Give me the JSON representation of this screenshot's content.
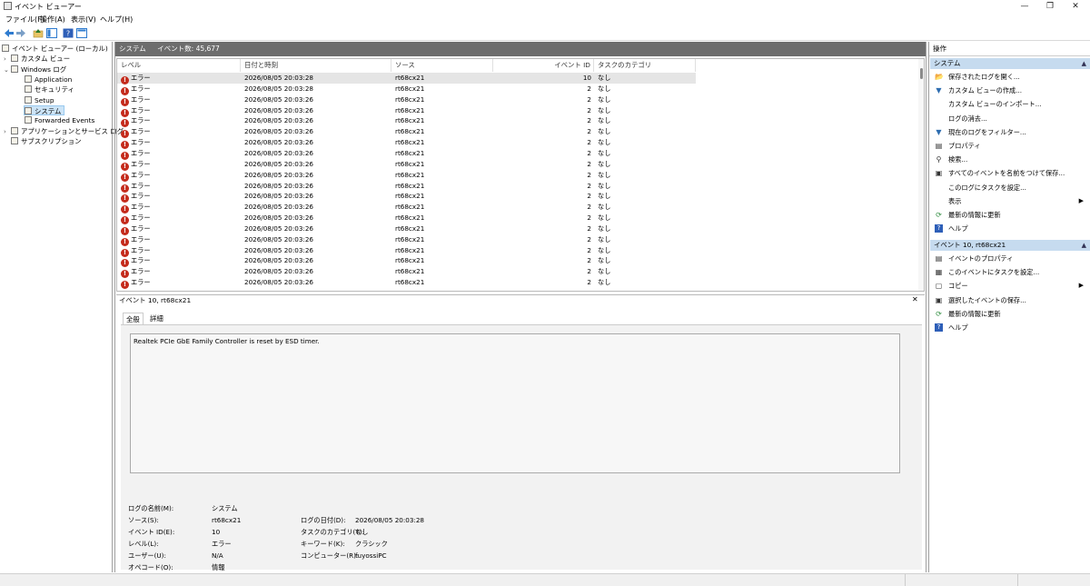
{
  "window": {
    "title": "イベント ビューアー",
    "min_glyph": "—",
    "max_glyph": "❐",
    "close_glyph": "✕"
  },
  "menu": [
    "ファイル(F)",
    "操作(A)",
    "表示(V)",
    "ヘルプ(H)"
  ],
  "tree": {
    "root": "イベント ビューアー (ローカル)",
    "custom_views": "カスタム ビュー",
    "windows_logs": "Windows ログ",
    "logs": [
      "Application",
      "セキュリティ",
      "Setup",
      "システム",
      "Forwarded Events"
    ],
    "app_services": "アプリケーションとサービス ログ",
    "subscriptions": "サブスクリプション"
  },
  "center": {
    "log_name": "システム",
    "event_count": "イベント数: 45,677"
  },
  "grid": {
    "columns": [
      "レベル",
      "日付と時刻",
      "ソース",
      "イベント ID",
      "タスクのカテゴリ"
    ],
    "rows": [
      {
        "level": "エラー",
        "datetime": "2026/08/05 20:03:28",
        "source": "rt68cx21",
        "event_id": "10",
        "category": "なし"
      },
      {
        "level": "エラー",
        "datetime": "2026/08/05 20:03:28",
        "source": "rt68cx21",
        "event_id": "2",
        "category": "なし"
      },
      {
        "level": "エラー",
        "datetime": "2026/08/05 20:03:26",
        "source": "rt68cx21",
        "event_id": "2",
        "category": "なし"
      },
      {
        "level": "エラー",
        "datetime": "2026/08/05 20:03:26",
        "source": "rt68cx21",
        "event_id": "2",
        "category": "なし"
      },
      {
        "level": "エラー",
        "datetime": "2026/08/05 20:03:26",
        "source": "rt68cx21",
        "event_id": "2",
        "category": "なし"
      },
      {
        "level": "エラー",
        "datetime": "2026/08/05 20:03:26",
        "source": "rt68cx21",
        "event_id": "2",
        "category": "なし"
      },
      {
        "level": "エラー",
        "datetime": "2026/08/05 20:03:26",
        "source": "rt68cx21",
        "event_id": "2",
        "category": "なし"
      },
      {
        "level": "エラー",
        "datetime": "2026/08/05 20:03:26",
        "source": "rt68cx21",
        "event_id": "2",
        "category": "なし"
      },
      {
        "level": "エラー",
        "datetime": "2026/08/05 20:03:26",
        "source": "rt68cx21",
        "event_id": "2",
        "category": "なし"
      },
      {
        "level": "エラー",
        "datetime": "2026/08/05 20:03:26",
        "source": "rt68cx21",
        "event_id": "2",
        "category": "なし"
      },
      {
        "level": "エラー",
        "datetime": "2026/08/05 20:03:26",
        "source": "rt68cx21",
        "event_id": "2",
        "category": "なし"
      },
      {
        "level": "エラー",
        "datetime": "2026/08/05 20:03:26",
        "source": "rt68cx21",
        "event_id": "2",
        "category": "なし"
      },
      {
        "level": "エラー",
        "datetime": "2026/08/05 20:03:26",
        "source": "rt68cx21",
        "event_id": "2",
        "category": "なし"
      },
      {
        "level": "エラー",
        "datetime": "2026/08/05 20:03:26",
        "source": "rt68cx21",
        "event_id": "2",
        "category": "なし"
      },
      {
        "level": "エラー",
        "datetime": "2026/08/05 20:03:26",
        "source": "rt68cx21",
        "event_id": "2",
        "category": "なし"
      },
      {
        "level": "エラー",
        "datetime": "2026/08/05 20:03:26",
        "source": "rt68cx21",
        "event_id": "2",
        "category": "なし"
      },
      {
        "level": "エラー",
        "datetime": "2026/08/05 20:03:26",
        "source": "rt68cx21",
        "event_id": "2",
        "category": "なし"
      },
      {
        "level": "エラー",
        "datetime": "2026/08/05 20:03:26",
        "source": "rt68cx21",
        "event_id": "2",
        "category": "なし"
      },
      {
        "level": "エラー",
        "datetime": "2026/08/05 20:03:26",
        "source": "rt68cx21",
        "event_id": "2",
        "category": "なし"
      },
      {
        "level": "エラー",
        "datetime": "2026/08/05 20:03:26",
        "source": "rt68cx21",
        "event_id": "2",
        "category": "なし"
      }
    ]
  },
  "detail": {
    "header": "イベント 10, rt68cx21",
    "close_glyph": "✕",
    "tab_general": "全般",
    "tab_details": "詳細",
    "message": "Realtek PCIe GbE Family Controller is reset by ESD timer.",
    "fields": {
      "log_name_label": "ログの名前(M):",
      "log_name": "システム",
      "source_label": "ソース(S):",
      "source": "rt68cx21",
      "logged_label": "ログの日付(D):",
      "logged": "2026/08/05 20:03:28",
      "event_id_label": "イベント ID(E):",
      "event_id": "10",
      "task_label": "タスクのカテゴリ(Y):",
      "task": "なし",
      "level_label": "レベル(L):",
      "level": "エラー",
      "keywords_label": "キーワード(K):",
      "keywords": "クラシック",
      "user_label": "ユーザー(U):",
      "user": "N/A",
      "computer_label": "コンピューター(R):",
      "computer": "fuyossiPC",
      "opcode_label": "オペコード(O):",
      "opcode": "情報"
    }
  },
  "actions": {
    "header": "操作",
    "section1": "システム",
    "items1": [
      {
        "label": "保存されたログを開く...",
        "icon": "open-log-icon"
      },
      {
        "label": "カスタム ビューの作成...",
        "icon": "filter-icon"
      },
      {
        "label": "カスタム ビューのインポート...",
        "icon": ""
      },
      {
        "label": "ログの消去...",
        "icon": ""
      },
      {
        "label": "現在のログをフィルター...",
        "icon": "filter-icon"
      },
      {
        "label": "プロパティ",
        "icon": "properties-icon"
      },
      {
        "label": "検索...",
        "icon": "find-icon"
      },
      {
        "label": "すべてのイベントを名前をつけて保存...",
        "icon": "save-icon"
      },
      {
        "label": "このログにタスクを設定...",
        "icon": ""
      },
      {
        "label": "表示",
        "icon": "",
        "submenu": true
      },
      {
        "label": "最新の情報に更新",
        "icon": "refresh-icon"
      },
      {
        "label": "ヘルプ",
        "icon": "help-icon",
        "submenu": true
      }
    ],
    "section2": "イベント 10, rt68cx21",
    "items2": [
      {
        "label": "イベントのプロパティ",
        "icon": "properties-icon"
      },
      {
        "label": "このイベントにタスクを設定...",
        "icon": "task-icon"
      },
      {
        "label": "コピー",
        "icon": "copy-icon",
        "submenu": true
      },
      {
        "label": "選択したイベントの保存...",
        "icon": "save-icon"
      },
      {
        "label": "最新の情報に更新",
        "icon": "refresh-icon"
      },
      {
        "label": "ヘルプ",
        "icon": "help-icon",
        "submenu": true
      }
    ]
  },
  "colors": {
    "header_gray": "#6d6d6d",
    "section_blue": "#c6dbef",
    "error_red": "#c42b1c",
    "selection": "#cce4f7"
  }
}
